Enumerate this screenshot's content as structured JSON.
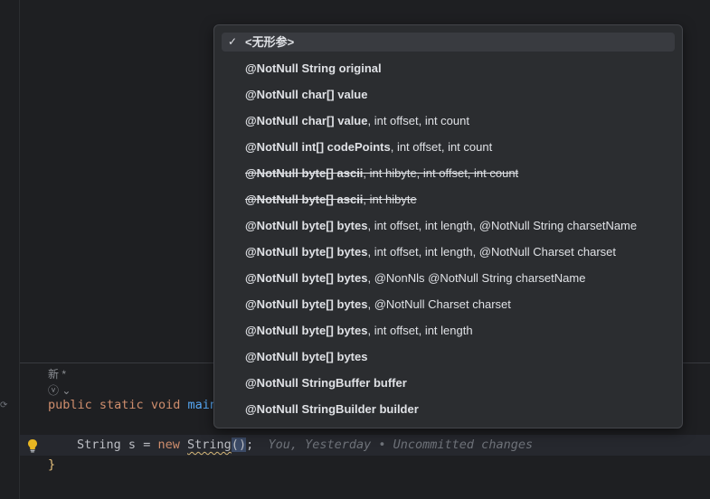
{
  "editor": {
    "inlay_line1": "新 *",
    "inlay_line2": "ⓥ ⌄",
    "method_line": {
      "kw1": "public",
      "kw2": "static",
      "kw3": "void",
      "name": "main"
    },
    "code_line": {
      "type": "String",
      "var": "s",
      "eq": "=",
      "new_kw": "new",
      "ctor": "String",
      "open": "(",
      "close": ")",
      "semi": ";"
    },
    "blame_hint": "You, Yesterday • Uncommitted changes",
    "close_brace": "}"
  },
  "popup": {
    "items": [
      {
        "bold": "<无形参>",
        "rest": "",
        "selected": true,
        "deprecated": false
      },
      {
        "bold": "@NotNull String original",
        "rest": "",
        "selected": false,
        "deprecated": false
      },
      {
        "bold": "@NotNull char[] value",
        "rest": "",
        "selected": false,
        "deprecated": false
      },
      {
        "bold": "@NotNull char[] value",
        "rest": ", int offset, int count",
        "selected": false,
        "deprecated": false
      },
      {
        "bold": "@NotNull int[] codePoints",
        "rest": ", int offset, int count",
        "selected": false,
        "deprecated": false
      },
      {
        "bold": "@NotNull byte[] ascii",
        "rest": ", int hibyte, int offset, int count",
        "selected": false,
        "deprecated": true
      },
      {
        "bold": "@NotNull byte[] ascii",
        "rest": ", int hibyte",
        "selected": false,
        "deprecated": true
      },
      {
        "bold": "@NotNull byte[] bytes",
        "rest": ", int offset, int length, @NotNull String charsetName",
        "selected": false,
        "deprecated": false
      },
      {
        "bold": "@NotNull byte[] bytes",
        "rest": ", int offset, int length, @NotNull Charset charset",
        "selected": false,
        "deprecated": false
      },
      {
        "bold": "@NotNull byte[] bytes",
        "rest": ", @NonNls @NotNull String charsetName",
        "selected": false,
        "deprecated": false
      },
      {
        "bold": "@NotNull byte[] bytes",
        "rest": ", @NotNull Charset charset",
        "selected": false,
        "deprecated": false
      },
      {
        "bold": "@NotNull byte[] bytes",
        "rest": ", int offset, int length",
        "selected": false,
        "deprecated": false
      },
      {
        "bold": "@NotNull byte[] bytes",
        "rest": "",
        "selected": false,
        "deprecated": false
      },
      {
        "bold": "@NotNull StringBuffer buffer",
        "rest": "",
        "selected": false,
        "deprecated": false
      },
      {
        "bold": "@NotNull StringBuilder builder",
        "rest": "",
        "selected": false,
        "deprecated": false
      }
    ]
  }
}
